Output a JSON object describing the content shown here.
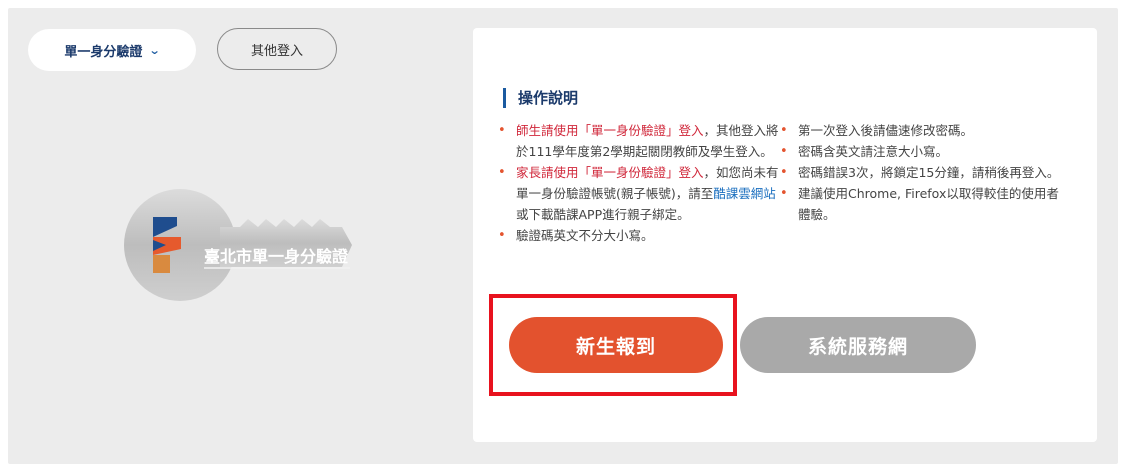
{
  "header": {
    "login_select_label": "單一身分驗證",
    "other_login_label": "其他登入"
  },
  "logo": {
    "text": "臺北市單一身分驗證"
  },
  "instructions": {
    "title": "操作說明",
    "left": [
      {
        "red": "師生請使用「單一身份驗證」登入",
        "rest": "，其他登入將於111學年度第2學期起關閉教師及學生登入。"
      },
      {
        "red": "家長請使用「單一身份驗證」登入",
        "rest": "，如您尚未有單一身份驗證帳號(親子帳號)，請至",
        "link": "酷課雲網站",
        "tail": "或下載酷課APP進行親子綁定。"
      },
      {
        "text": "驗證碼英文不分大小寫。"
      }
    ],
    "right": [
      "第一次登入後請儘速修改密碼。",
      "密碼含英文請注意大小寫。",
      "密碼錯誤3次，將鎖定15分鐘，請稍後再登入。",
      "建議使用Chrome, Firefox以取得較佳的使用者體驗。"
    ]
  },
  "buttons": {
    "new_student": "新生報到",
    "system_service": "系統服務網"
  },
  "colors": {
    "accent": "#e3522e",
    "highlight": "#e8121e",
    "brand_blue": "#1b3a6b"
  }
}
